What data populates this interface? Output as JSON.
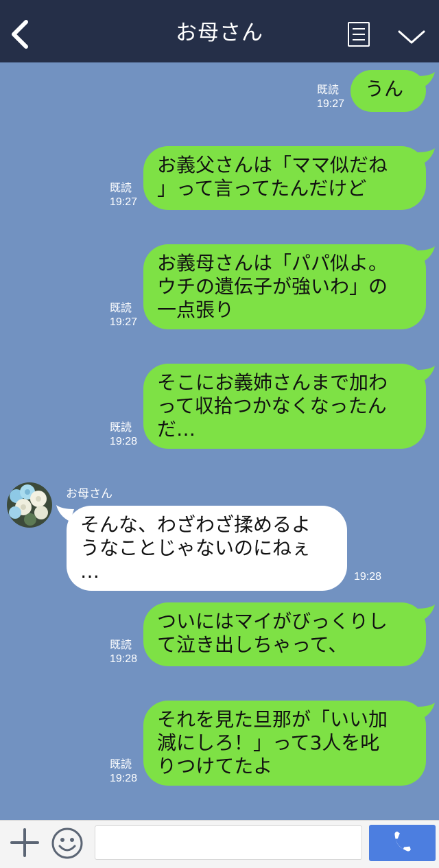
{
  "header": {
    "title": "お母さん",
    "back_icon": "chevron-left-icon",
    "menu_icon": "menu-list-icon",
    "expand_icon": "chevron-down-icon"
  },
  "colors": {
    "header_bg": "#252f48",
    "chat_bg": "#7292c1",
    "outgoing_bubble": "#7ee145",
    "incoming_bubble": "#ffffff",
    "call_button": "#4c7ee0"
  },
  "messages": [
    {
      "direction": "out",
      "text": "うん",
      "read": "既読",
      "time": "19:27"
    },
    {
      "direction": "out",
      "text": "お義父さんは「ママ似だね\n」って言ってたんだけど",
      "read": "既読",
      "time": "19:27"
    },
    {
      "direction": "out",
      "text": "お義母さんは「パパ似よ。\nウチの遺伝子が強いわ」の\n一点張り",
      "read": "既読",
      "time": "19:27"
    },
    {
      "direction": "out",
      "text": "そこにお義姉さんまで加わ\nって収拾つかなくなったん\nだ…",
      "read": "既読",
      "time": "19:28"
    },
    {
      "direction": "in",
      "sender": "お母さん",
      "text": "そんな、わざわざ揉めるよ\nうなことじゃないのにねぇ\n…",
      "time": "19:28"
    },
    {
      "direction": "out",
      "text": "ついにはマイがびっくりし\nて泣き出しちゃって、",
      "read": "既読",
      "time": "19:28"
    },
    {
      "direction": "out",
      "text": "それを見た旦那が「いい加\n減にしろ！」って3人を叱\nりつけてたよ",
      "read": "既読",
      "time": "19:28"
    }
  ],
  "input_bar": {
    "plus_icon": "plus-icon",
    "emoji_icon": "smiley-icon",
    "input_value": "",
    "call_icon": "phone-icon"
  }
}
